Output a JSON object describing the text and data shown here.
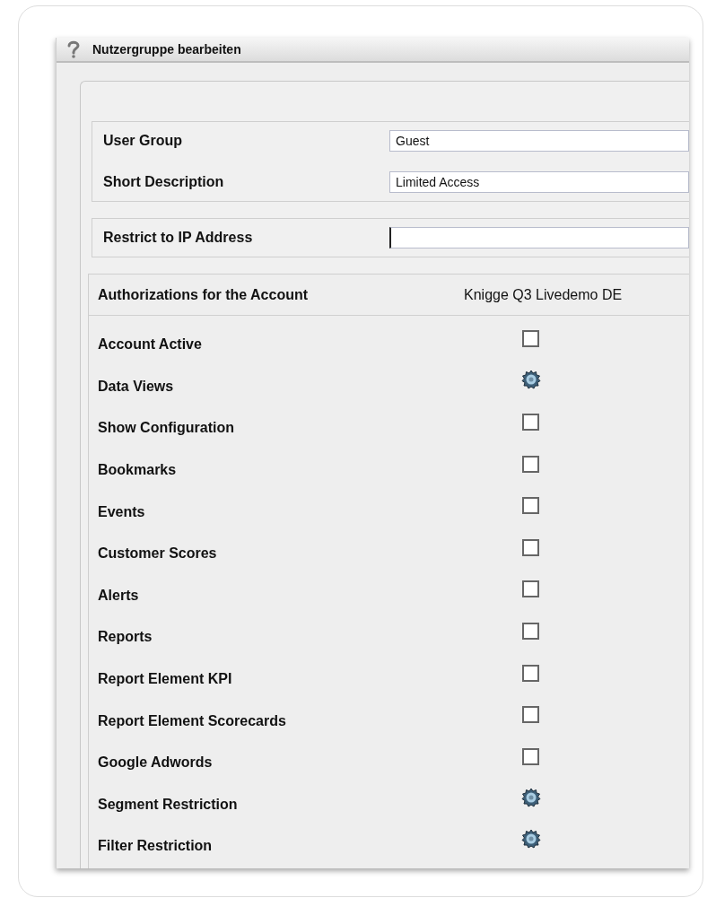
{
  "window": {
    "title": "Nutzergruppe bearbeiten"
  },
  "fields": [
    {
      "label": "User Group",
      "value": "Guest"
    },
    {
      "label": "Short Description",
      "value": "Limited Access"
    }
  ],
  "ip_field": {
    "label": "Restrict to IP Address",
    "focused": true
  },
  "permissions": {
    "columns": [
      "Authorizations for the Account",
      "Knigge Q3 Livedemo DE"
    ],
    "rows": [
      {
        "label": "Account Active",
        "kind": "checkbox",
        "checked": false
      },
      {
        "label": "Data Views",
        "kind": "gear"
      },
      {
        "label": "Show Configuration",
        "kind": "checkbox",
        "checked": false
      },
      {
        "label": "Bookmarks",
        "kind": "checkbox",
        "checked": false
      },
      {
        "label": "Events",
        "kind": "checkbox",
        "checked": false
      },
      {
        "label": "Customer Scores",
        "kind": "checkbox",
        "checked": false
      },
      {
        "label": "Alerts",
        "kind": "checkbox",
        "checked": false
      },
      {
        "label": "Reports",
        "kind": "checkbox",
        "checked": false
      },
      {
        "label": "Report Element KPI",
        "kind": "checkbox",
        "checked": false
      },
      {
        "label": "Report Element Scorecards",
        "kind": "checkbox",
        "checked": false
      },
      {
        "label": "Google Adwords",
        "kind": "checkbox",
        "checked": false
      },
      {
        "label": "Segment Restriction",
        "kind": "gear"
      },
      {
        "label": "Filter Restriction",
        "kind": "gear"
      }
    ]
  }
}
